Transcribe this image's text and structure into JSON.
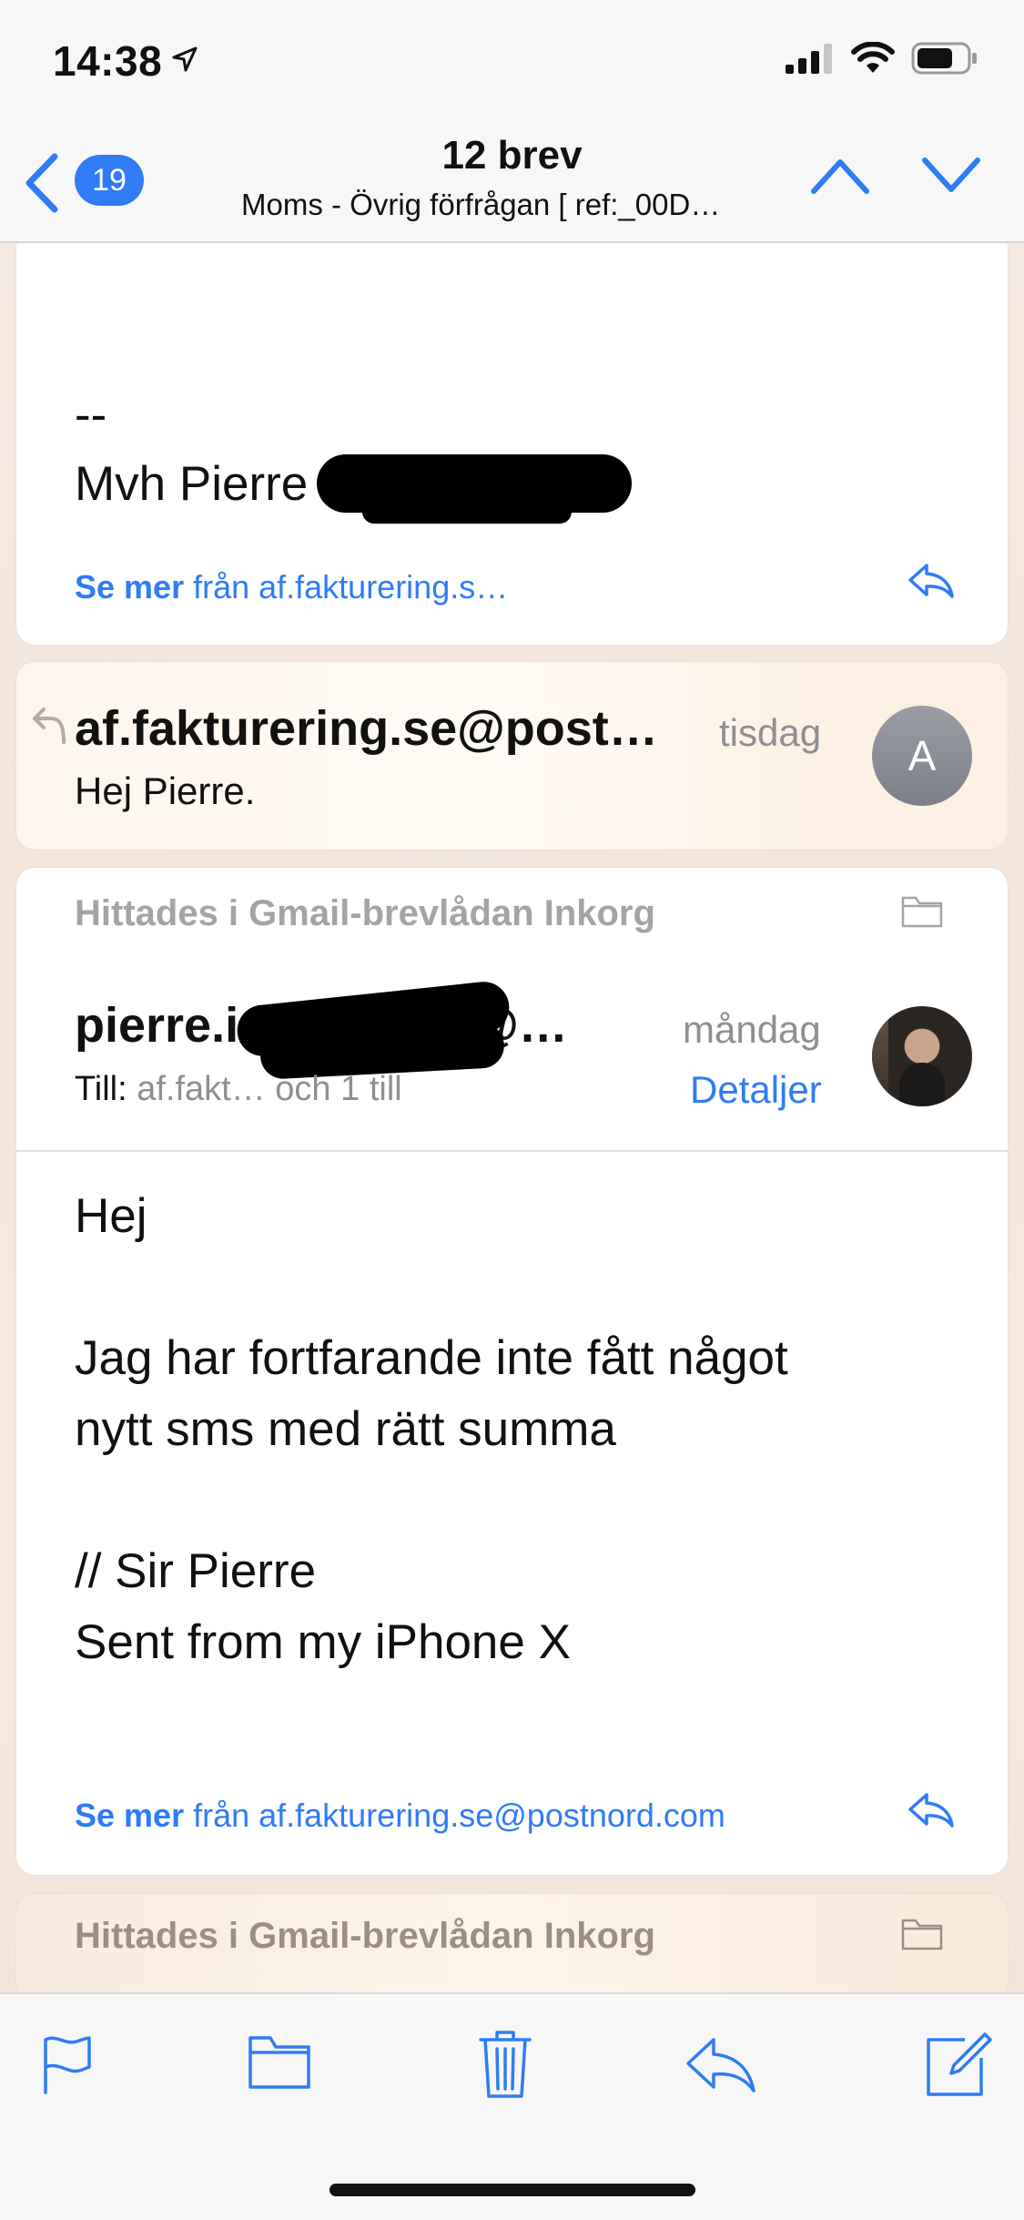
{
  "status": {
    "time": "14:38"
  },
  "nav": {
    "back_count": "19",
    "title": "12 brev",
    "subtitle": "Moms - Övrig förfrågan    [ ref:_00D…"
  },
  "message1": {
    "dashes": "--",
    "signature": "Mvh Pierre",
    "see_more_bold": "Se mer",
    "see_more_rest": " från af.fakturering.s…"
  },
  "message2": {
    "sender": "af.fakturering.se@post…",
    "date": "tisdag",
    "preview": "Hej Pierre.",
    "avatar_letter": "A"
  },
  "message3": {
    "mailbox_note": "Hittades i Gmail-brevlådan Inkorg",
    "sender": "pierre.i",
    "sender_tail": "@…",
    "date": "måndag",
    "to_label": "Till:",
    "to_value": " af.fakt… och 1 till",
    "details": "Detaljer",
    "body_lines": [
      "Hej",
      "",
      "Jag har fortfarande inte fått något",
      "nytt sms med rätt summa",
      "",
      "// Sir Pierre",
      "Sent from my iPhone X"
    ],
    "see_more_bold": "Se mer",
    "see_more_rest": " från af.fakturering.se@postnord.com"
  },
  "message4": {
    "mailbox_note": "Hittades i Gmail-brevlådan Inkorg"
  },
  "toolbar": {
    "icons": [
      "flag-icon",
      "folder-icon",
      "trash-icon",
      "reply-icon",
      "compose-icon"
    ]
  },
  "colors": {
    "accent": "#2f7cf6",
    "gray_text": "#8e8e93"
  }
}
